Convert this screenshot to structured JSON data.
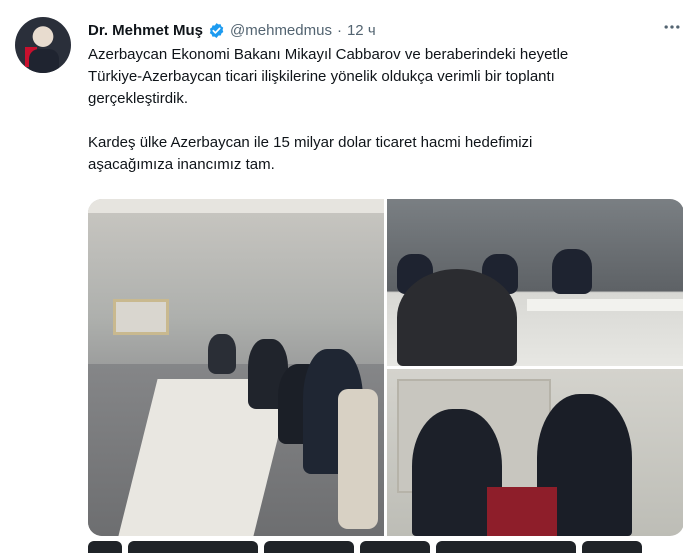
{
  "author": {
    "name": "Dr. Mehmet Muş",
    "handle": "@mehmedmus",
    "separator": "·",
    "time": "12 ч",
    "verified_color": "#1d9bf0"
  },
  "tweet": {
    "paragraph1": "Azerbaycan Ekonomi Bakanı Mikayıl Cabbarov ve beraberindeki heyetle\nTürkiye-Azerbaycan ticari ilişkilerine yönelik oldukça verimli bir toplantı\ngerçekleştirdik.",
    "paragraph2": "Kardeş ülke Azerbaycan ile 15 milyar dolar ticaret hacmi hedefimizi\naşacağımıza inancımız tam."
  },
  "icons": {
    "more": "more-options-icon",
    "verified": "verified-badge-icon"
  }
}
